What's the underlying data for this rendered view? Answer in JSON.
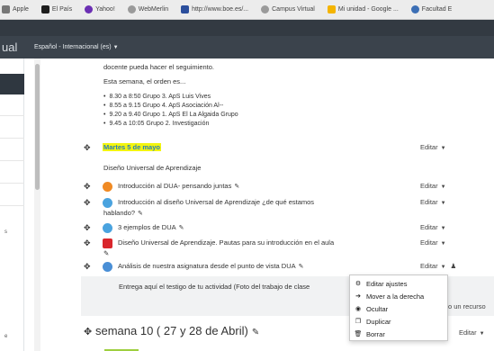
{
  "bookmarks": [
    {
      "label": "Apple",
      "color": "#777777"
    },
    {
      "label": "El País",
      "color": "#1d1d1d"
    },
    {
      "label": "Yahoo!",
      "color": "#6b2fb3"
    },
    {
      "label": "WebMerlin",
      "color": "#9a9a9a"
    },
    {
      "label": "http://www.boe.es/...",
      "color": "#2b4e9c"
    },
    {
      "label": "Campus Virtual",
      "color": "#9a9a9a"
    },
    {
      "label": "Mi unidad - Google ...",
      "color": "#f4b400"
    },
    {
      "label": "Facultad E",
      "color": "#3c6fb5"
    }
  ],
  "brand_fragment": "ual",
  "language": "Español - Internacional (es)",
  "left_fragments": [
    "s",
    "e"
  ],
  "intro": {
    "line1": "docente pueda hacer el seguimiento.",
    "line2": "Esta semana, el orden es...",
    "bullets": [
      "8.30 a 8:50 Grupo 3. ApS Luis Vives",
      "8.55 a 9.15 Grupo 4. ApS Asociación Al--",
      "9.20 a 9.40 Grupo 1.  ApS El La Algaida Grupo",
      "9.45 a 10:05  Grupo 2. Investigación"
    ]
  },
  "section_label": "Martes 5 de mayo",
  "section_subtitle": "Diseño Universal de Aprendizaje",
  "edit_label": "Editar",
  "activities": [
    {
      "text": "Introducción al DUA- pensando juntas",
      "icon_color": "#f08a24"
    },
    {
      "text": "Introducción al diseño Universal de Aprendizaje ¿de qué estamos",
      "text2": "hablando?",
      "icon_color": "#4aa3df"
    },
    {
      "text": "3 ejemplos de DUA",
      "icon_color": "#4aa3df"
    },
    {
      "text": "Diseño Universal de Aprendizaje. Pautas para su introducción en el aula",
      "icon_color": "#d9262c"
    },
    {
      "text": "Análisis de nuestra asignatura desde el punto de vista DUA",
      "icon_color": "#4a8fd6"
    }
  ],
  "submission_text": "Entrega aquí el testigo de tu actividad (Foto del trabajo de clase",
  "add_resource_fragment": "o un recurso",
  "menu": [
    {
      "label": "Editar ajustes",
      "icon": "gear-icon",
      "glyph": "⚙"
    },
    {
      "label": "Mover a la derecha",
      "icon": "arrow-right-icon",
      "glyph": "➔"
    },
    {
      "label": "Ocultar",
      "icon": "eye-icon",
      "glyph": "◉"
    },
    {
      "label": "Duplicar",
      "icon": "copy-icon",
      "glyph": "❐"
    },
    {
      "label": "Borrar",
      "icon": "trash-icon",
      "glyph": "🗑"
    }
  ],
  "week": {
    "title": "semana 10 ( 27 y 28 de Abril)",
    "edit": "Editar"
  }
}
